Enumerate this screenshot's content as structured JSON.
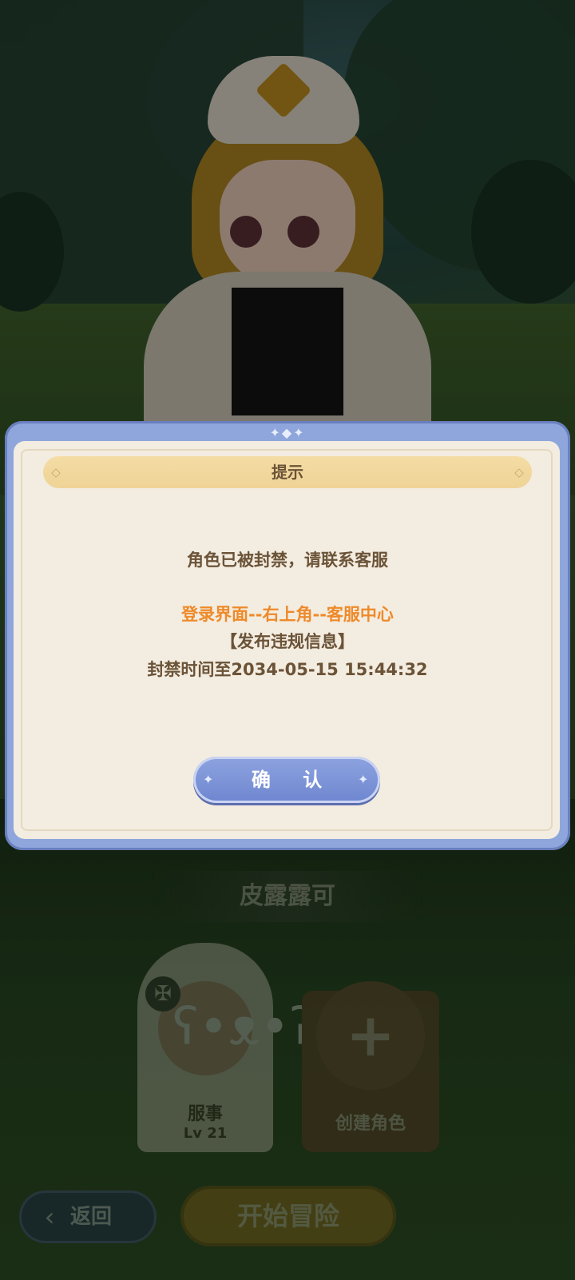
{
  "dialog": {
    "title": "提示",
    "message": "角色已被封禁，请联系客服",
    "path_hint": "登录界面--右上角--客服中心",
    "reason": "【发布违规信息】",
    "ban_until": "封禁时间至2034-05-15  15:44:32",
    "confirm_label": "确 认"
  },
  "character": {
    "name": "皮露露可"
  },
  "roles": [
    {
      "name": "服事",
      "level": "Lv 21"
    }
  ],
  "create_role_label": "创建角色",
  "back_label": "返回",
  "start_label": "开始冒险",
  "colors": {
    "dialog_frame": "#8fa6dc",
    "dialog_bg": "#f3ece0",
    "title_bar": "#f4dca4",
    "highlight_text": "#ee8a2a",
    "body_text": "#6b5338",
    "confirm_button": "#7c93d6"
  }
}
